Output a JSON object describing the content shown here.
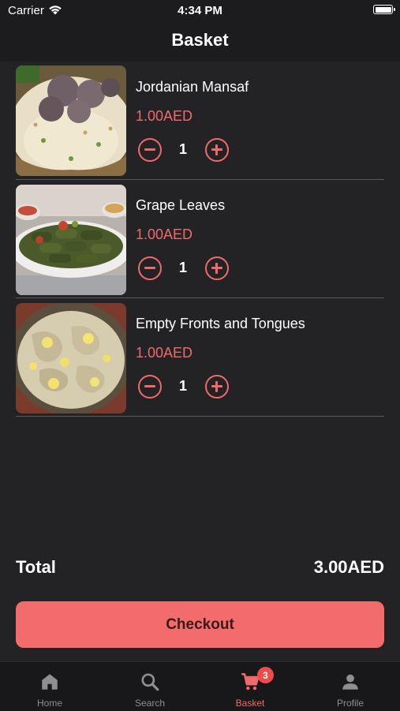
{
  "status_bar": {
    "carrier": "Carrier",
    "time": "4:34 PM"
  },
  "header": {
    "title": "Basket"
  },
  "items": [
    {
      "name": "Jordanian Mansaf",
      "price": "1.00AED",
      "quantity": "1"
    },
    {
      "name": "Grape Leaves",
      "price": "1.00AED",
      "quantity": "1"
    },
    {
      "name": "Empty Fronts and Tongues",
      "price": "1.00AED",
      "quantity": "1"
    }
  ],
  "total": {
    "label": "Total",
    "value": "3.00AED"
  },
  "checkout": {
    "label": "Checkout"
  },
  "tabs": [
    {
      "label": "Home",
      "icon": "home-icon"
    },
    {
      "label": "Search",
      "icon": "search-icon"
    },
    {
      "label": "Basket",
      "icon": "cart-icon",
      "badge": "3"
    },
    {
      "label": "Profile",
      "icon": "person-icon"
    }
  ],
  "colors": {
    "accent": "#f16a6a",
    "background": "#232326",
    "button": "#f26c6c",
    "badge": "#ef4b4b"
  }
}
